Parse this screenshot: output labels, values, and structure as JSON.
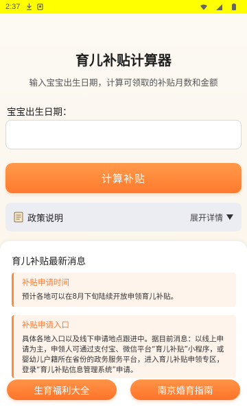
{
  "status_bar": {
    "time": "2:37",
    "background": "#ffff00",
    "icons": [
      "download-icon",
      "app-notification-icon",
      "wifi-icon",
      "signal-icon",
      "battery-icon"
    ]
  },
  "header": {
    "title": "育儿补贴计算器",
    "subtitle": "输入宝宝出生日期，计算可领取的补贴月数和金额"
  },
  "form": {
    "birth_label": "宝宝出生日期：",
    "birth_value": "",
    "calc_button": "计算补贴"
  },
  "policy": {
    "label": "政策说明",
    "expand_label": "展开详情"
  },
  "news": {
    "heading": "育儿补贴最新消息",
    "items": [
      {
        "title": "补贴申请时间",
        "text": "预计各地可以在8月下旬陆续开放申领育儿补贴。"
      },
      {
        "title": "补贴申请入口",
        "text": "具体各地入口以及线下申请地点跟进中。据目前消息：以线上申请为主，申领人可通过支付宝、微信平台“育儿补贴”小程序，或婴幼儿户籍所在省份的政务服务平台，进入育儿补贴申领专区，登录“育儿补贴信息管理系统”申请。"
      }
    ]
  },
  "bottom_bar": {
    "left_button": "生育福利大全",
    "right_button": "南京婚育指南"
  },
  "colors": {
    "accent": "#ff7a2e",
    "notice_bg": "#fff4ec",
    "policy_bg": "#ececf3"
  }
}
